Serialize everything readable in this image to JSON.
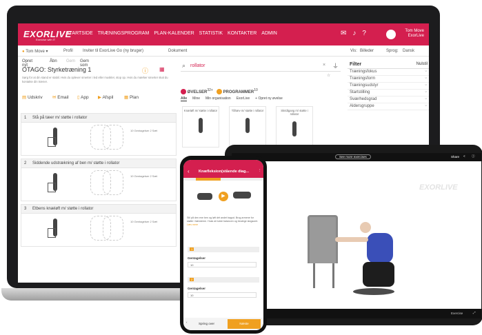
{
  "colors": {
    "brand": "#d41f4f",
    "accent": "#f0a020"
  },
  "laptop": {
    "logo": "EXORLIVE",
    "logo_sub": "Exercise with IT",
    "nav": [
      "STARTSIDE",
      "TRÆNINGSPROGRAM",
      "PLAN-KALENDER",
      "STATISTIK",
      "KONTAKTER",
      "ADMIN"
    ],
    "user_name": "Tom Move",
    "user_org": "ExorLive",
    "sub": {
      "user": "Tom Move",
      "profile": "Profil",
      "invite": "Inviter til ExorLive Go (ny bruger)",
      "document": "Dokument",
      "view_label": "Vis:",
      "view_value": "Billeder",
      "lang_label": "Sprog:",
      "lang_value": "Dansk"
    },
    "actions": {
      "new": "Opret nyt",
      "open": "Åbn",
      "save": "Gem",
      "save_as": "Gem som"
    },
    "program_title": "OTAGO: Styrketræning 1",
    "program_desc": "Sørg for at din stand er stabil. Hvis du oplever smerter i led eller muskler, stop op. Hvis du mærker smerter skal du kontakte din træner.",
    "share": {
      "print": "Udskriv",
      "email": "Email",
      "app": "App",
      "play": "Afspil",
      "plan": "Plan"
    },
    "exercises": [
      {
        "num": "1",
        "title": "Stå på tæer m/ støtte i rollator",
        "sets": "10 Gentagelser 2 Sæt"
      },
      {
        "num": "2",
        "title": "Siddende udstrækning af ben m/ støtte i rollator",
        "sets": "10 Gentagelser 2 Sæt"
      },
      {
        "num": "3",
        "title": "Etbens knæløft m/ støtte i rollator",
        "sets": "10 Gentagelser 2 Sæt"
      }
    ],
    "search": {
      "value": "rollator"
    },
    "tabs": {
      "exercises": "ØVELSER",
      "exercises_count": "32+",
      "programs": "PROGRAMMER",
      "programs_count": "10"
    },
    "subtabs": [
      "Alle",
      "Mine",
      "Min organisation",
      "ExorLive",
      "+ Opret ny øvelse"
    ],
    "thumbs": [
      "Knæløft m/ støtte i rollator",
      "Tåhæv m/ støtte i rollator",
      "Skridtgang m/ støtte i rollator"
    ],
    "filter": {
      "title": "Filter",
      "reset": "Nulstil",
      "rows": [
        "Træningsfokus",
        "Træningsform",
        "Træningsudstyr",
        "Startstilling",
        "Sværhedsgrad",
        "Aldersgruppe"
      ]
    }
  },
  "tablet": {
    "top_btn": "See more exercises",
    "share": "Share",
    "logo": "EXORLIVE",
    "bottom": "Exercise"
  },
  "phone": {
    "title": "Knæfleksion(stående diag...",
    "text": "Stil på den ene ben og løft dét andet bagud. Brug armene for støtte i hænderne. Husk at holde balancen og bevæge langsomt.",
    "link": "Læs mere",
    "fields": [
      {
        "num": "1",
        "label": "Gentagelser",
        "value": "10"
      },
      {
        "num": "2",
        "label": "Gentagelser",
        "value": "10"
      }
    ],
    "bottom_left": "Spring over",
    "bottom_right": "Næste"
  }
}
